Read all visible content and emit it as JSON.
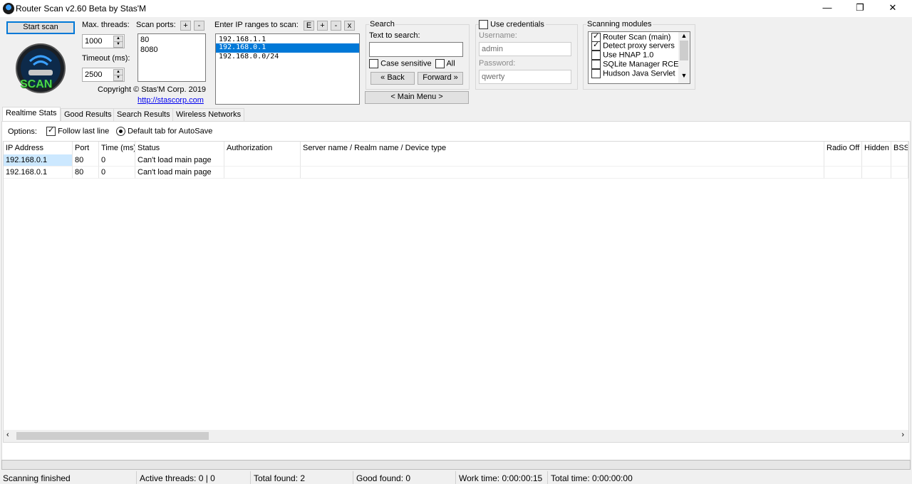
{
  "window": {
    "title": "Router Scan v2.60 Beta by Stas'M",
    "minimize": "—",
    "maximize": "❐",
    "close": "✕"
  },
  "controls": {
    "start_scan": "Start scan",
    "max_threads_label": "Max. threads:",
    "max_threads_value": "1000",
    "timeout_label": "Timeout (ms):",
    "timeout_value": "2500",
    "scan_ports_label": "Scan ports:",
    "scan_ports": [
      "80",
      "8080"
    ],
    "plus": "+",
    "minus": "-",
    "copyright": "Copyright © Stas'M Corp. 2019",
    "link": "http://stascorp.com",
    "logo_text": "SCAN"
  },
  "ip_ranges": {
    "label": "Enter IP ranges to scan:",
    "buttons": [
      "E",
      "+",
      "-",
      "x"
    ],
    "items": [
      "192.168.1.1",
      "192.168.0.1",
      "192.168.0.0/24"
    ],
    "selected_index": 1
  },
  "search": {
    "group_title": "Search",
    "text_label": "Text to search:",
    "value": "",
    "case_sensitive": "Case sensitive",
    "all": "All",
    "back": "« Back",
    "forward": "Forward »",
    "main_menu": "< Main Menu >"
  },
  "credentials": {
    "use_label": "Use credentials",
    "username_label": "Username:",
    "username": "admin",
    "password_label": "Password:",
    "password": "qwerty"
  },
  "modules": {
    "title": "Scanning modules",
    "items": [
      {
        "label": "Router Scan (main)",
        "checked": true
      },
      {
        "label": "Detect proxy servers",
        "checked": true
      },
      {
        "label": "Use HNAP 1.0",
        "checked": false
      },
      {
        "label": "SQLite Manager RCE",
        "checked": false
      },
      {
        "label": "Hudson Java Servlet",
        "checked": false
      }
    ]
  },
  "tabs": [
    "Realtime Stats",
    "Good Results",
    "Search Results",
    "Wireless Networks"
  ],
  "options": {
    "label": "Options:",
    "follow_last_line": "Follow last line",
    "default_tab": "Default tab for AutoSave"
  },
  "table": {
    "columns": [
      "IP Address",
      "Port",
      "Time (ms)",
      "Status",
      "Authorization",
      "Server name / Realm name / Device type",
      "Radio Off",
      "Hidden",
      "BSSI"
    ],
    "rows": [
      [
        "192.168.0.1",
        "80",
        "0",
        "Can't load main page",
        "",
        "",
        "",
        "",
        ""
      ],
      [
        "192.168.0.1",
        "80",
        "0",
        "Can't load main page",
        "",
        "",
        "",
        "",
        ""
      ]
    ]
  },
  "status_bar": {
    "state": "Scanning finished",
    "active_threads": "Active threads: 0 | 0",
    "total_found": "Total found: 2",
    "good_found": "Good found: 0",
    "work_time": "Work time: 0:00:00:15",
    "total_time": "Total time: 0:00:00:00"
  }
}
